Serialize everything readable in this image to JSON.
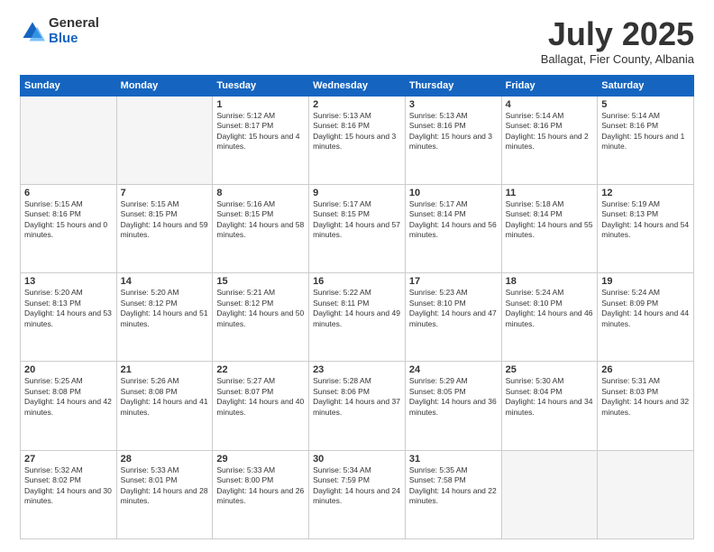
{
  "logo": {
    "general": "General",
    "blue": "Blue"
  },
  "title": "July 2025",
  "subtitle": "Ballagat, Fier County, Albania",
  "days_of_week": [
    "Sunday",
    "Monday",
    "Tuesday",
    "Wednesday",
    "Thursday",
    "Friday",
    "Saturday"
  ],
  "weeks": [
    [
      {
        "day": "",
        "empty": true
      },
      {
        "day": "",
        "empty": true
      },
      {
        "day": "1",
        "sunrise": "5:12 AM",
        "sunset": "8:17 PM",
        "daylight": "15 hours and 4 minutes."
      },
      {
        "day": "2",
        "sunrise": "5:13 AM",
        "sunset": "8:16 PM",
        "daylight": "15 hours and 3 minutes."
      },
      {
        "day": "3",
        "sunrise": "5:13 AM",
        "sunset": "8:16 PM",
        "daylight": "15 hours and 3 minutes."
      },
      {
        "day": "4",
        "sunrise": "5:14 AM",
        "sunset": "8:16 PM",
        "daylight": "15 hours and 2 minutes."
      },
      {
        "day": "5",
        "sunrise": "5:14 AM",
        "sunset": "8:16 PM",
        "daylight": "15 hours and 1 minute."
      }
    ],
    [
      {
        "day": "6",
        "sunrise": "5:15 AM",
        "sunset": "8:16 PM",
        "daylight": "15 hours and 0 minutes."
      },
      {
        "day": "7",
        "sunrise": "5:15 AM",
        "sunset": "8:15 PM",
        "daylight": "14 hours and 59 minutes."
      },
      {
        "day": "8",
        "sunrise": "5:16 AM",
        "sunset": "8:15 PM",
        "daylight": "14 hours and 58 minutes."
      },
      {
        "day": "9",
        "sunrise": "5:17 AM",
        "sunset": "8:15 PM",
        "daylight": "14 hours and 57 minutes."
      },
      {
        "day": "10",
        "sunrise": "5:17 AM",
        "sunset": "8:14 PM",
        "daylight": "14 hours and 56 minutes."
      },
      {
        "day": "11",
        "sunrise": "5:18 AM",
        "sunset": "8:14 PM",
        "daylight": "14 hours and 55 minutes."
      },
      {
        "day": "12",
        "sunrise": "5:19 AM",
        "sunset": "8:13 PM",
        "daylight": "14 hours and 54 minutes."
      }
    ],
    [
      {
        "day": "13",
        "sunrise": "5:20 AM",
        "sunset": "8:13 PM",
        "daylight": "14 hours and 53 minutes."
      },
      {
        "day": "14",
        "sunrise": "5:20 AM",
        "sunset": "8:12 PM",
        "daylight": "14 hours and 51 minutes."
      },
      {
        "day": "15",
        "sunrise": "5:21 AM",
        "sunset": "8:12 PM",
        "daylight": "14 hours and 50 minutes."
      },
      {
        "day": "16",
        "sunrise": "5:22 AM",
        "sunset": "8:11 PM",
        "daylight": "14 hours and 49 minutes."
      },
      {
        "day": "17",
        "sunrise": "5:23 AM",
        "sunset": "8:10 PM",
        "daylight": "14 hours and 47 minutes."
      },
      {
        "day": "18",
        "sunrise": "5:24 AM",
        "sunset": "8:10 PM",
        "daylight": "14 hours and 46 minutes."
      },
      {
        "day": "19",
        "sunrise": "5:24 AM",
        "sunset": "8:09 PM",
        "daylight": "14 hours and 44 minutes."
      }
    ],
    [
      {
        "day": "20",
        "sunrise": "5:25 AM",
        "sunset": "8:08 PM",
        "daylight": "14 hours and 42 minutes."
      },
      {
        "day": "21",
        "sunrise": "5:26 AM",
        "sunset": "8:08 PM",
        "daylight": "14 hours and 41 minutes."
      },
      {
        "day": "22",
        "sunrise": "5:27 AM",
        "sunset": "8:07 PM",
        "daylight": "14 hours and 40 minutes."
      },
      {
        "day": "23",
        "sunrise": "5:28 AM",
        "sunset": "8:06 PM",
        "daylight": "14 hours and 37 minutes."
      },
      {
        "day": "24",
        "sunrise": "5:29 AM",
        "sunset": "8:05 PM",
        "daylight": "14 hours and 36 minutes."
      },
      {
        "day": "25",
        "sunrise": "5:30 AM",
        "sunset": "8:04 PM",
        "daylight": "14 hours and 34 minutes."
      },
      {
        "day": "26",
        "sunrise": "5:31 AM",
        "sunset": "8:03 PM",
        "daylight": "14 hours and 32 minutes."
      }
    ],
    [
      {
        "day": "27",
        "sunrise": "5:32 AM",
        "sunset": "8:02 PM",
        "daylight": "14 hours and 30 minutes."
      },
      {
        "day": "28",
        "sunrise": "5:33 AM",
        "sunset": "8:01 PM",
        "daylight": "14 hours and 28 minutes."
      },
      {
        "day": "29",
        "sunrise": "5:33 AM",
        "sunset": "8:00 PM",
        "daylight": "14 hours and 26 minutes."
      },
      {
        "day": "30",
        "sunrise": "5:34 AM",
        "sunset": "7:59 PM",
        "daylight": "14 hours and 24 minutes."
      },
      {
        "day": "31",
        "sunrise": "5:35 AM",
        "sunset": "7:58 PM",
        "daylight": "14 hours and 22 minutes."
      },
      {
        "day": "",
        "empty": true
      },
      {
        "day": "",
        "empty": true
      }
    ]
  ]
}
